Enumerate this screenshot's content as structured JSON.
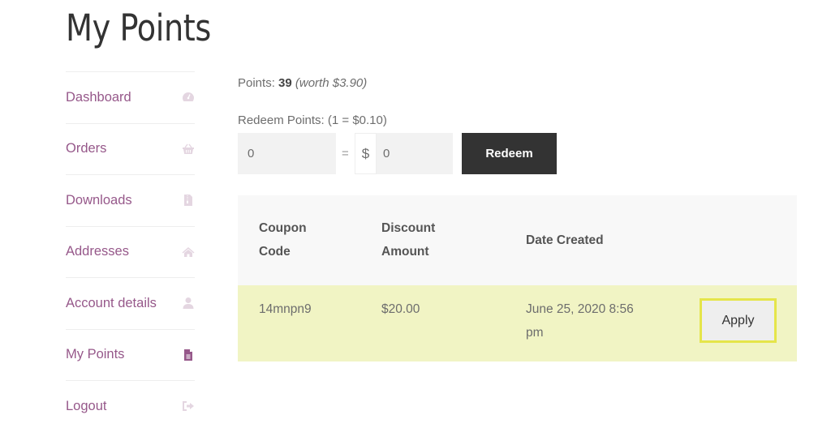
{
  "page": {
    "title": "My Points"
  },
  "nav": {
    "items": [
      {
        "label": "Dashboard",
        "icon": "dashboard-gauge-icon",
        "active": false
      },
      {
        "label": "Orders",
        "icon": "basket-icon",
        "active": false
      },
      {
        "label": "Downloads",
        "icon": "file-archive-icon",
        "active": false
      },
      {
        "label": "Addresses",
        "icon": "home-icon",
        "active": false
      },
      {
        "label": "Account details",
        "icon": "user-icon",
        "active": false
      },
      {
        "label": "My Points",
        "icon": "file-text-icon",
        "active": true
      },
      {
        "label": "Logout",
        "icon": "sign-out-icon",
        "active": false
      }
    ]
  },
  "points": {
    "label": "Points:",
    "value": "39",
    "worth": "(worth $3.90)"
  },
  "redeem": {
    "label": "Redeem Points: (1 = $0.10)",
    "points_value": "0",
    "equals": "=",
    "currency": "$",
    "amount_value": "0",
    "button_label": "Redeem"
  },
  "coupons": {
    "headers": [
      "Coupon\nCode",
      "Discount\nAmount",
      "Date Created",
      ""
    ],
    "header_lines": [
      [
        "Coupon",
        "Code"
      ],
      [
        "Discount",
        "Amount"
      ],
      [
        "Date Created"
      ]
    ],
    "rows": [
      {
        "code": "14mnpn9",
        "amount": "$20.00",
        "date_line1": "June 25, 2020 8:56",
        "date_line2": "pm",
        "action": "Apply"
      }
    ]
  },
  "colors": {
    "accent": "#96588a",
    "row_highlight": "#f1f4c4",
    "apply_border": "#e5e54a",
    "button_dark": "#333333"
  }
}
